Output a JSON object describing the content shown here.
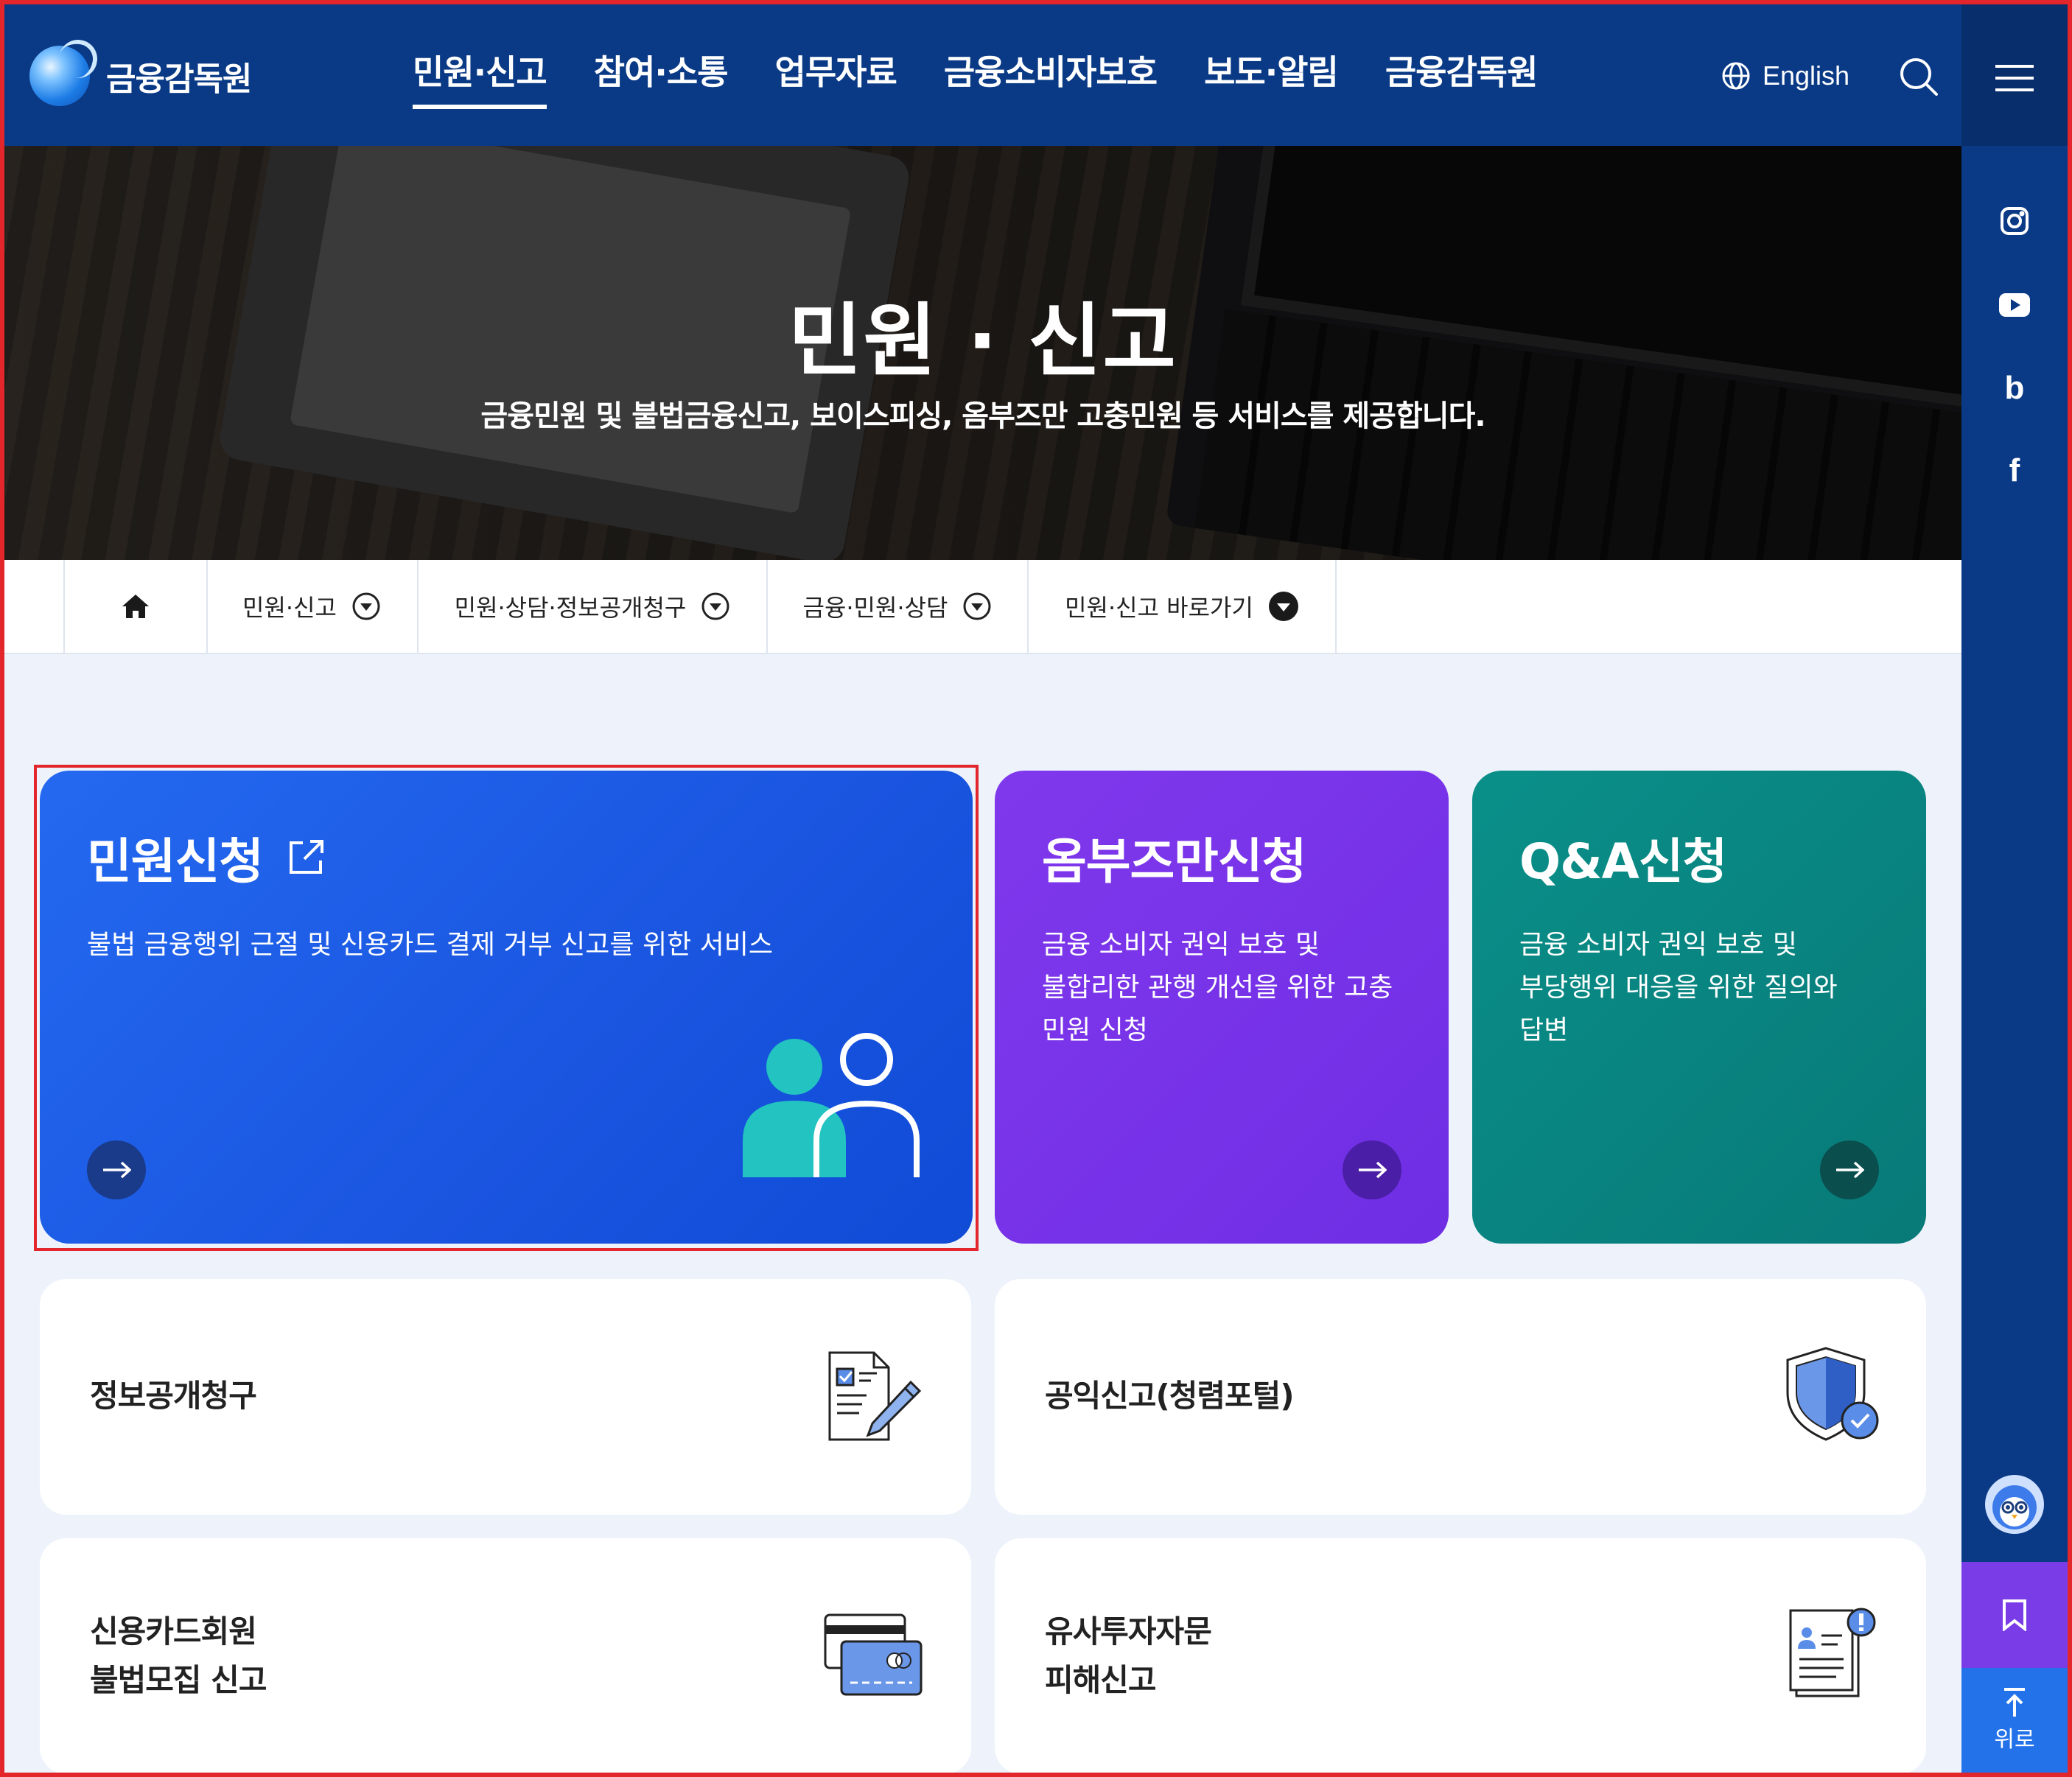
{
  "header": {
    "logo_text": "금융감독원",
    "nav": [
      "민원·신고",
      "참여·소통",
      "업무자료",
      "금융소비자보호",
      "보도·알림",
      "금융감독원"
    ],
    "active_nav": 0,
    "language_label": "English"
  },
  "rail": {
    "sns_icons": [
      "instagram-icon",
      "youtube-icon",
      "blog-icon",
      "facebook-icon"
    ],
    "blog_glyph": "b",
    "facebook_glyph": "f",
    "top_label": "위로"
  },
  "hero": {
    "title": "민원 · 신고",
    "subtitle": "금융민원 및 불법금융신고, 보이스피싱, 옴부즈만 고충민원 등 서비스를 제공합니다."
  },
  "breadcrumb": {
    "items": [
      "민원·신고",
      "민원·상담·정보공개청구",
      "금융·민원·상담",
      "민원·신고 바로가기"
    ]
  },
  "feature_cards": [
    {
      "title": "민원신청",
      "desc": [
        "불법 금융행위 근절 및 신용카드 결제 거부 신고를 위한 서비스"
      ],
      "color": "#1f63ea"
    },
    {
      "title": "옴부즈만신청",
      "desc": [
        "금융 소비자 권익 보호 및",
        "불합리한 관행 개선을 위한 고충",
        "민원 신청"
      ],
      "color": "#7b33e8"
    },
    {
      "title": "Q&A신청",
      "desc": [
        "금융 소비자 권익 보호 및",
        "부당행위 대응을 위한 질의와",
        "답변"
      ],
      "color": "#0a8882"
    }
  ],
  "service_cards": [
    {
      "label": [
        "정보공개청구"
      ],
      "icon": "document-edit-icon"
    },
    {
      "label": [
        "공익신고(청렴포털)"
      ],
      "icon": "shield-check-icon"
    },
    {
      "label": [
        "신용카드회원",
        "불법모집 신고"
      ],
      "icon": "credit-card-icon"
    },
    {
      "label": [
        "유사투자자문",
        "피해신고"
      ],
      "icon": "report-document-icon"
    }
  ]
}
